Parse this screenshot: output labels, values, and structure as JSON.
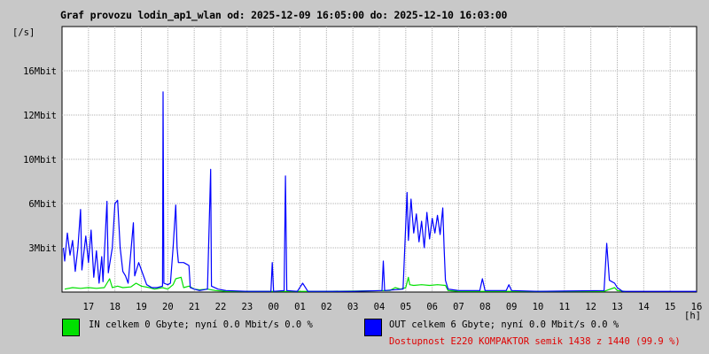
{
  "title": "Graf provozu lodin_ap1_wlan od: 2025-12-09 16:05:00 do: 2025-12-10 16:03:00",
  "colors": {
    "background": "#c8c8c8",
    "plot_background": "#ffffff",
    "grid": "#b0b0b0",
    "in_series": "#00e000",
    "out_series": "#0000ff",
    "availability": "#e00000"
  },
  "legend": {
    "in_text": "IN celkem 0 Gbyte; nyní   0.0 Mbit/s 0.0 %",
    "out_text": "OUT celkem 6 Gbyte; nyní   0.0 Mbit/s 0.0 %",
    "in_swatch_color": "#00e000",
    "out_swatch_color": "#0000ff"
  },
  "availability_text": "Dostupnost E220 KOMPAKTOR semik 1438 z 1440 (99.9 %)",
  "chart_data": {
    "type": "line",
    "ylabel": "[/s]",
    "xlabel": "[h]",
    "y_ticks": [
      {
        "label": "3Mbit",
        "value": 3
      },
      {
        "label": "6Mbit",
        "value": 6
      },
      {
        "label": "10Mbit",
        "value": 10
      },
      {
        "label": "12Mbit",
        "value": 12
      },
      {
        "label": "16Mbit",
        "value": 16
      }
    ],
    "x_ticks": [
      "17",
      "18",
      "19",
      "20",
      "21",
      "22",
      "23",
      "00",
      "01",
      "02",
      "03",
      "04",
      "05",
      "06",
      "07",
      "08",
      "09",
      "10",
      "11",
      "12",
      "13",
      "14",
      "15",
      "16"
    ],
    "legend_placement": "bottom",
    "grid": true,
    "series": [
      {
        "name": "IN",
        "color": "#00e000",
        "points": [
          [
            16.1,
            0.2
          ],
          [
            16.4,
            0.3
          ],
          [
            16.7,
            0.25
          ],
          [
            17.0,
            0.3
          ],
          [
            17.3,
            0.25
          ],
          [
            17.6,
            0.3
          ],
          [
            17.8,
            0.9
          ],
          [
            17.9,
            0.3
          ],
          [
            18.1,
            0.4
          ],
          [
            18.3,
            0.3
          ],
          [
            18.6,
            0.35
          ],
          [
            18.8,
            0.6
          ],
          [
            19.0,
            0.4
          ],
          [
            19.3,
            0.3
          ],
          [
            19.5,
            0.2
          ],
          [
            19.8,
            0.3
          ],
          [
            20.0,
            0.2
          ],
          [
            20.2,
            0.5
          ],
          [
            20.3,
            0.9
          ],
          [
            20.5,
            1.0
          ],
          [
            20.6,
            0.3
          ],
          [
            20.8,
            0.4
          ],
          [
            21.0,
            0.2
          ],
          [
            21.2,
            0.15
          ],
          [
            21.5,
            0.2
          ],
          [
            21.8,
            0.1
          ],
          [
            22.2,
            0.05
          ],
          [
            23.0,
            0.05
          ],
          [
            0.5,
            0.05
          ],
          [
            2.0,
            0.05
          ],
          [
            4.4,
            0.1
          ],
          [
            4.6,
            0.3
          ],
          [
            4.8,
            0.2
          ],
          [
            5.0,
            0.3
          ],
          [
            5.1,
            1.0
          ],
          [
            5.15,
            0.5
          ],
          [
            5.3,
            0.45
          ],
          [
            5.6,
            0.5
          ],
          [
            5.9,
            0.45
          ],
          [
            6.2,
            0.5
          ],
          [
            6.5,
            0.45
          ],
          [
            6.6,
            0.1
          ],
          [
            7.0,
            0.05
          ],
          [
            8.0,
            0.05
          ],
          [
            9.0,
            0.05
          ],
          [
            12.5,
            0.05
          ],
          [
            12.9,
            0.3
          ],
          [
            13.0,
            0.1
          ],
          [
            13.3,
            0.05
          ]
        ]
      },
      {
        "name": "OUT",
        "color": "#0000ff",
        "points": [
          [
            16.05,
            3.0
          ],
          [
            16.1,
            2.1
          ],
          [
            16.2,
            4.0
          ],
          [
            16.3,
            2.5
          ],
          [
            16.4,
            3.5
          ],
          [
            16.5,
            1.4
          ],
          [
            16.6,
            3.0
          ],
          [
            16.7,
            5.6
          ],
          [
            16.75,
            1.5
          ],
          [
            16.9,
            3.8
          ],
          [
            17.0,
            2.0
          ],
          [
            17.1,
            4.2
          ],
          [
            17.2,
            1.0
          ],
          [
            17.3,
            2.8
          ],
          [
            17.4,
            0.6
          ],
          [
            17.5,
            2.4
          ],
          [
            17.55,
            0.7
          ],
          [
            17.7,
            6.2
          ],
          [
            17.75,
            1.3
          ],
          [
            17.9,
            3.0
          ],
          [
            18.0,
            6.0
          ],
          [
            18.1,
            6.3
          ],
          [
            18.2,
            3.0
          ],
          [
            18.3,
            1.4
          ],
          [
            18.4,
            1.1
          ],
          [
            18.5,
            0.6
          ],
          [
            18.7,
            4.7
          ],
          [
            18.75,
            1.1
          ],
          [
            18.9,
            2.0
          ],
          [
            19.0,
            1.5
          ],
          [
            19.1,
            1.0
          ],
          [
            19.2,
            0.5
          ],
          [
            19.4,
            0.3
          ],
          [
            19.6,
            0.3
          ],
          [
            19.8,
            0.4
          ],
          [
            19.82,
            14.1
          ],
          [
            19.85,
            0.6
          ],
          [
            20.0,
            0.5
          ],
          [
            20.1,
            0.6
          ],
          [
            20.2,
            3.0
          ],
          [
            20.3,
            5.9
          ],
          [
            20.35,
            3.0
          ],
          [
            20.4,
            2.0
          ],
          [
            20.5,
            2.0
          ],
          [
            20.6,
            2.0
          ],
          [
            20.7,
            1.9
          ],
          [
            20.8,
            1.8
          ],
          [
            20.85,
            0.3
          ],
          [
            21.0,
            0.2
          ],
          [
            21.2,
            0.1
          ],
          [
            21.5,
            0.2
          ],
          [
            21.62,
            9.1
          ],
          [
            21.65,
            0.4
          ],
          [
            21.9,
            0.2
          ],
          [
            22.2,
            0.1
          ],
          [
            23.0,
            0.05
          ],
          [
            23.9,
            0.05
          ],
          [
            23.95,
            2.0
          ],
          [
            24.0,
            0.05
          ],
          [
            24.4,
            0.1
          ],
          [
            24.45,
            8.5
          ],
          [
            24.5,
            0.1
          ],
          [
            24.9,
            0.05
          ],
          [
            25.1,
            0.6
          ],
          [
            25.3,
            0.05
          ],
          [
            27.0,
            0.05
          ],
          [
            28.1,
            0.1
          ],
          [
            28.15,
            2.1
          ],
          [
            28.2,
            0.1
          ],
          [
            28.9,
            0.2
          ],
          [
            29.05,
            7.0
          ],
          [
            29.1,
            3.5
          ],
          [
            29.2,
            6.4
          ],
          [
            29.3,
            4.0
          ],
          [
            29.4,
            5.3
          ],
          [
            29.5,
            3.4
          ],
          [
            29.6,
            4.8
          ],
          [
            29.7,
            3.0
          ],
          [
            29.8,
            5.4
          ],
          [
            29.9,
            3.6
          ],
          [
            30.0,
            5.0
          ],
          [
            30.1,
            4.0
          ],
          [
            30.2,
            5.2
          ],
          [
            30.3,
            3.9
          ],
          [
            30.4,
            5.7
          ],
          [
            30.45,
            3.0
          ],
          [
            30.5,
            0.8
          ],
          [
            30.6,
            0.2
          ],
          [
            31.0,
            0.1
          ],
          [
            31.8,
            0.1
          ],
          [
            31.9,
            0.9
          ],
          [
            32.0,
            0.1
          ],
          [
            32.8,
            0.1
          ],
          [
            32.9,
            0.5
          ],
          [
            33.0,
            0.1
          ],
          [
            34.0,
            0.05
          ],
          [
            36.5,
            0.1
          ],
          [
            36.6,
            3.3
          ],
          [
            36.7,
            0.8
          ],
          [
            36.9,
            0.6
          ],
          [
            37.0,
            0.3
          ],
          [
            37.2,
            0.05
          ],
          [
            40.0,
            0.05
          ]
        ]
      }
    ]
  }
}
